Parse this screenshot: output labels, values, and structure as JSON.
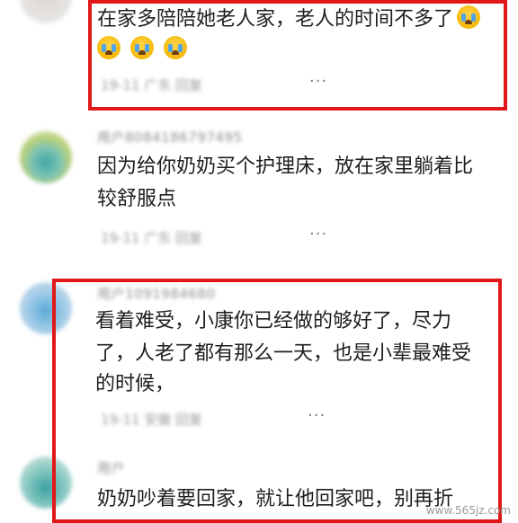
{
  "comments": [
    {
      "name": "",
      "lines": [
        "在家多陪陪她老人家，老人的时间不多了",
        ""
      ],
      "emoji_count_line1": 1,
      "emoji_count_line2": 3,
      "meta": "19-11 广东   回复",
      "more": "···"
    },
    {
      "name": "用户8084186797495",
      "lines": [
        "因为给你奶奶买个护理床，放在家里躺着比",
        "较舒服点"
      ],
      "meta": "19-11 广东   回复",
      "more": "···"
    },
    {
      "name": "用户1091984680",
      "lines": [
        "看着难受，小康你已经做的够好了，尽力",
        "了，人老了都有那么一天，也是小辈最难受",
        "的时候，"
      ],
      "meta": "19-11 安徽   回复",
      "more": "···"
    },
    {
      "name": "用户",
      "lines": [
        "奶奶吵着要回家，就让他回家吧，别再折"
      ],
      "meta": "",
      "more": ""
    }
  ],
  "watermark": "www.565jz.com",
  "colors": {
    "highlight": "#e01818",
    "emoji": "#f5b400"
  },
  "icons": [
    "crying-face-icon",
    "more-options-icon"
  ]
}
